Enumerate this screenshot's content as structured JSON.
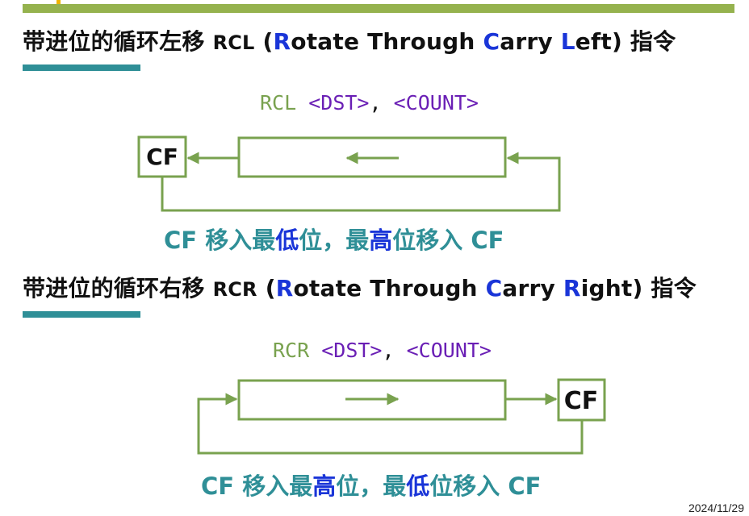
{
  "colors": {
    "top_bar": "#95b24e",
    "accent_teal": "#2f8f97",
    "highlight_blue": "#1a35d8",
    "diagram_green": "#79a24f",
    "arg_purple": "#6a1fb5"
  },
  "rcl": {
    "title_cn": "带进位的循环左移",
    "mnemonic": "RCL",
    "paren_open": "(",
    "r": "R",
    "otate": "otate Through ",
    "c": "C",
    "arry": "arry ",
    "side_letter": "L",
    "side_rest": "eft",
    "paren_close": ")",
    "title_suffix": "指令",
    "syntax_op": "RCL",
    "syntax_dst": "<DST>",
    "syntax_comma": ",",
    "syntax_count": "<COUNT>",
    "cf_label": "CF",
    "caption_1": "CF 移入最",
    "caption_hl_1": "低",
    "caption_2": "位，最",
    "caption_hl_2": "高",
    "caption_3": "位移入 CF"
  },
  "rcr": {
    "title_cn": "带进位的循环右移",
    "mnemonic": "RCR",
    "paren_open": "(",
    "r": "R",
    "otate": "otate Through ",
    "c": "C",
    "arry": "arry ",
    "side_letter": "R",
    "side_rest": "ight",
    "paren_close": ")",
    "title_suffix": "指令",
    "syntax_op": "RCR",
    "syntax_dst": "<DST>",
    "syntax_comma": ",",
    "syntax_count": "<COUNT>",
    "cf_label": "CF",
    "caption_1": "CF 移入最",
    "caption_hl_1": "高",
    "caption_2": "位，最",
    "caption_hl_2": "低",
    "caption_3": "位移入 CF"
  },
  "footer": {
    "date": "2024/11/29"
  }
}
